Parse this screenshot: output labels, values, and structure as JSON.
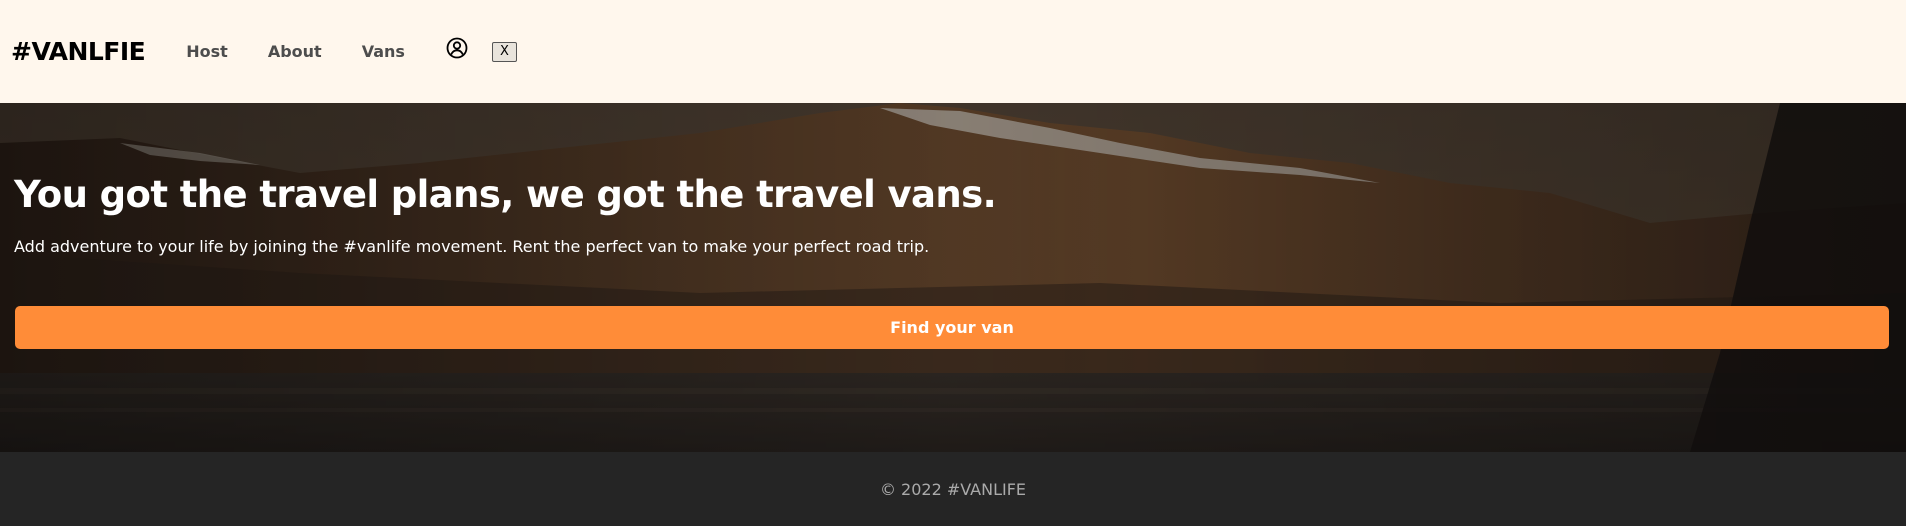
{
  "header": {
    "logo": "#VANLFIE",
    "nav": [
      {
        "label": "Host"
      },
      {
        "label": "About"
      },
      {
        "label": "Vans"
      }
    ],
    "user_icon": "user-circle-icon",
    "logout_label": "X"
  },
  "hero": {
    "title": "You got the travel plans, we got the travel vans.",
    "subtitle": "Add adventure to your life by joining the #vanlife movement. Rent the perfect van to make your perfect road trip.",
    "cta_label": "Find your van"
  },
  "footer": {
    "copyright": "© 2022 #VANLIFE"
  },
  "colors": {
    "header_bg": "#FFF7ED",
    "accent": "#FF8C38",
    "footer_bg": "#252525",
    "footer_text": "#AAAAAA"
  }
}
